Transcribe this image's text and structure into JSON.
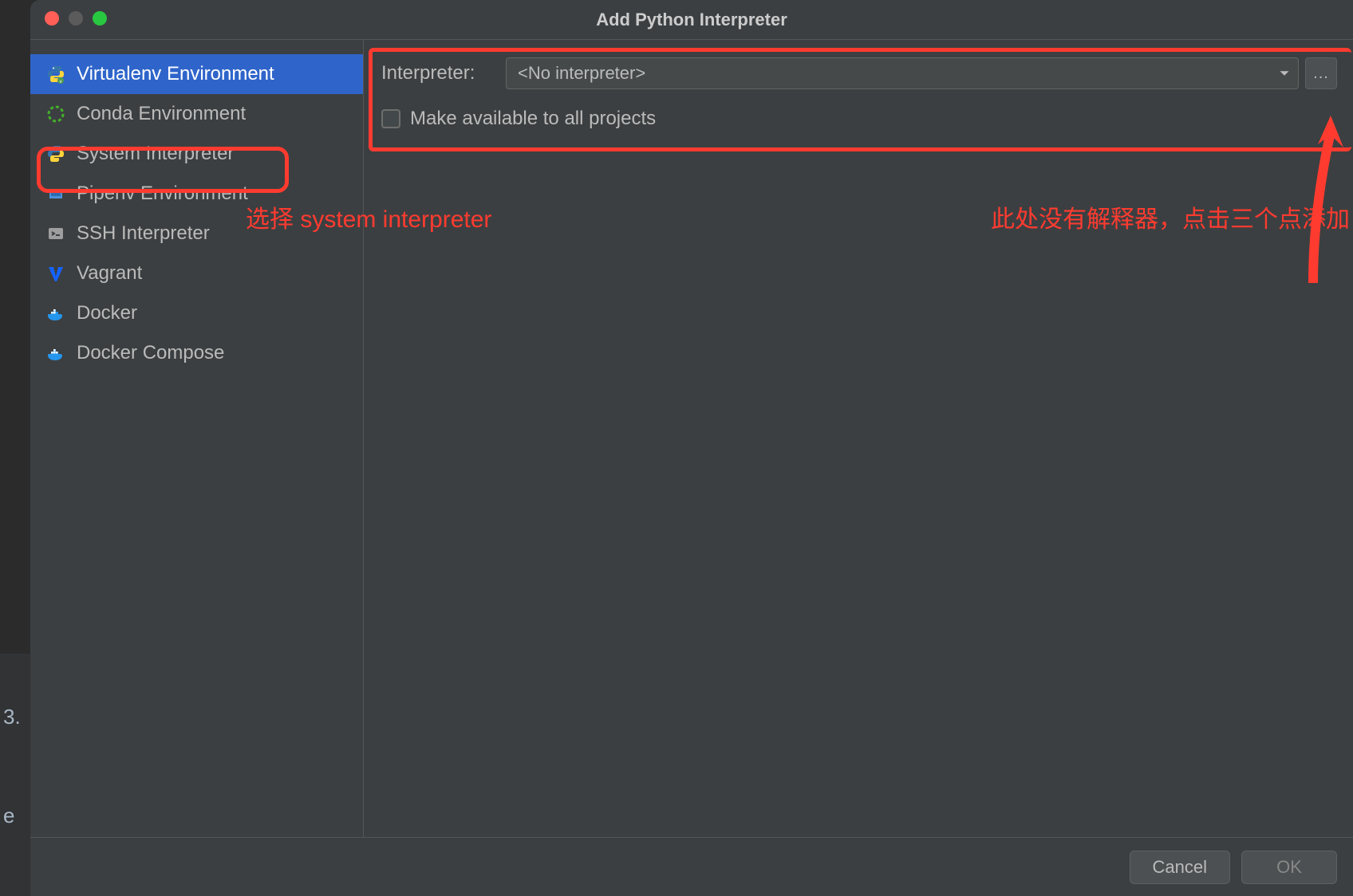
{
  "dialog": {
    "title": "Add Python Interpreter"
  },
  "sidebar": {
    "items": [
      {
        "label": "Virtualenv Environment",
        "icon": "python-venv-icon",
        "selected": true
      },
      {
        "label": "Conda Environment",
        "icon": "conda-icon",
        "selected": false
      },
      {
        "label": "System Interpreter",
        "icon": "python-icon",
        "selected": false
      },
      {
        "label": "Pipenv Environment",
        "icon": "pipenv-icon",
        "selected": false
      },
      {
        "label": "SSH Interpreter",
        "icon": "ssh-icon",
        "selected": false
      },
      {
        "label": "Vagrant",
        "icon": "vagrant-icon",
        "selected": false
      },
      {
        "label": "Docker",
        "icon": "docker-icon",
        "selected": false
      },
      {
        "label": "Docker Compose",
        "icon": "docker-compose-icon",
        "selected": false
      }
    ]
  },
  "main": {
    "interpreter_label": "Interpreter:",
    "interpreter_value": "<No interpreter>",
    "browse_button": "...",
    "make_available_label": "Make available to all projects"
  },
  "footer": {
    "cancel": "Cancel",
    "ok": "OK"
  },
  "annotations": {
    "left": "选择 system interpreter",
    "right": "此处没有解释器，点击三个点添加"
  },
  "bg_chars": {
    "a": "3.",
    "b": "e"
  },
  "colors": {
    "accent": "#2f65ca",
    "annotation": "#ff3b30",
    "bg": "#3c3f41"
  }
}
